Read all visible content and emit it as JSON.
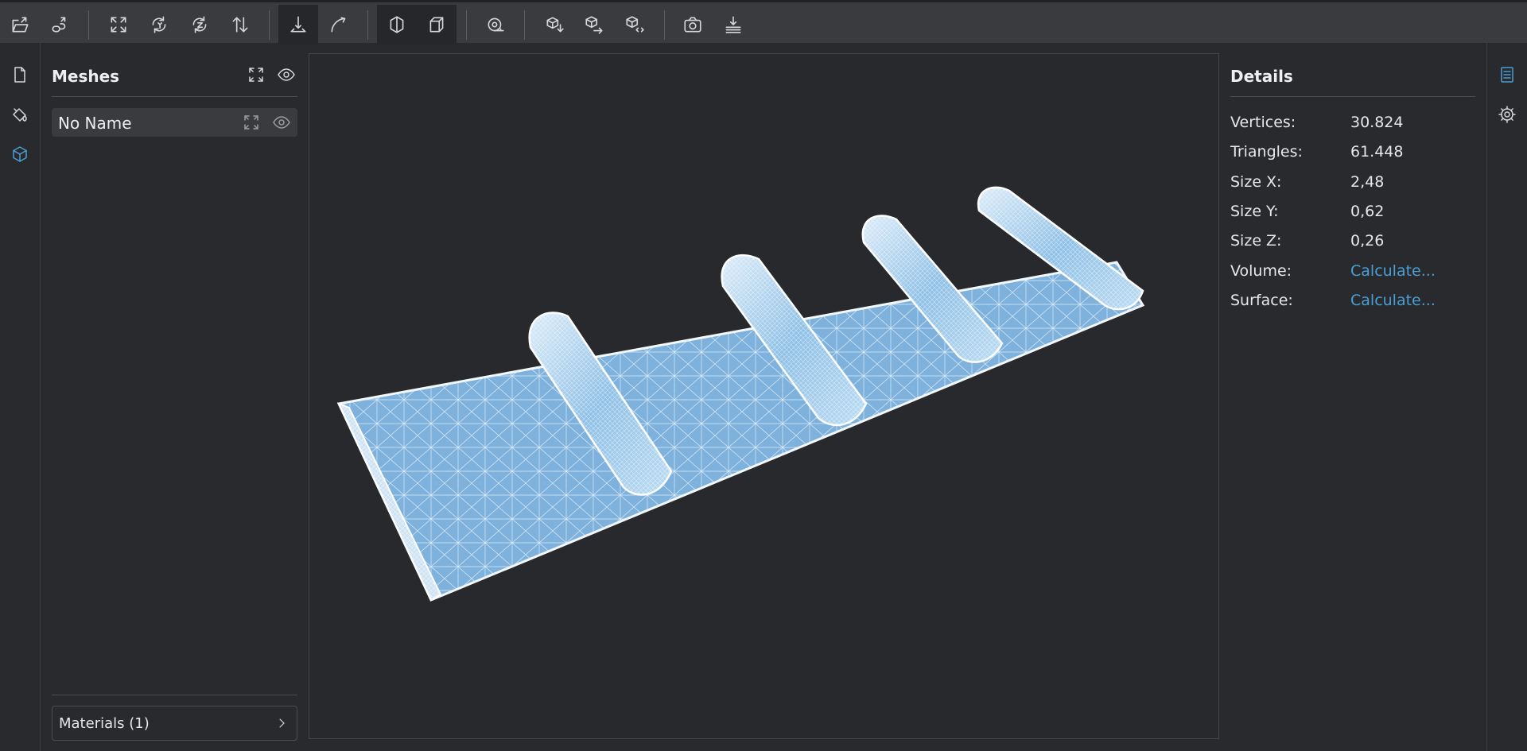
{
  "toolbar": {
    "buttons": [
      {
        "icon": "open-file-icon"
      },
      {
        "icon": "import-link-icon"
      },
      {
        "icon": "fit-view-icon"
      },
      {
        "icon": "rotate-y-icon"
      },
      {
        "icon": "rotate-z-icon"
      },
      {
        "icon": "flip-normals-icon"
      },
      {
        "icon": "place-on-ground-icon",
        "active": true
      },
      {
        "icon": "draw-path-icon"
      },
      {
        "icon": "shaded-view-icon",
        "active": true
      },
      {
        "icon": "wireframe-box-icon",
        "active": true
      },
      {
        "icon": "measure-tape-icon"
      },
      {
        "icon": "cube-down-icon"
      },
      {
        "icon": "cube-right-icon"
      },
      {
        "icon": "cube-code-icon"
      },
      {
        "icon": "camera-icon"
      },
      {
        "icon": "stamp-icon"
      }
    ]
  },
  "left_rail": {
    "items": [
      {
        "icon": "document-icon"
      },
      {
        "icon": "paint-bucket-icon"
      },
      {
        "icon": "cube-icon",
        "active": true
      }
    ]
  },
  "meshes": {
    "title": "Meshes",
    "items": [
      {
        "name": "No Name"
      }
    ],
    "materials_label": "Materials (1)"
  },
  "details": {
    "title": "Details",
    "rows": [
      {
        "key": "Vertices:",
        "value": "30.824"
      },
      {
        "key": "Triangles:",
        "value": "61.448"
      },
      {
        "key": "Size X:",
        "value": "2,48"
      },
      {
        "key": "Size Y:",
        "value": "0,62"
      },
      {
        "key": "Size Z:",
        "value": "0,26"
      },
      {
        "key": "Volume:",
        "value": "Calculate...",
        "link": true
      },
      {
        "key": "Surface:",
        "value": "Calculate...",
        "link": true
      }
    ]
  },
  "right_rail": {
    "items": [
      {
        "icon": "details-list-icon",
        "active": true
      },
      {
        "icon": "settings-gear-icon"
      }
    ]
  },
  "colors": {
    "accent": "#4a9fd3",
    "mesh_fill": "#7eb2dd",
    "background": "#292a2d"
  }
}
